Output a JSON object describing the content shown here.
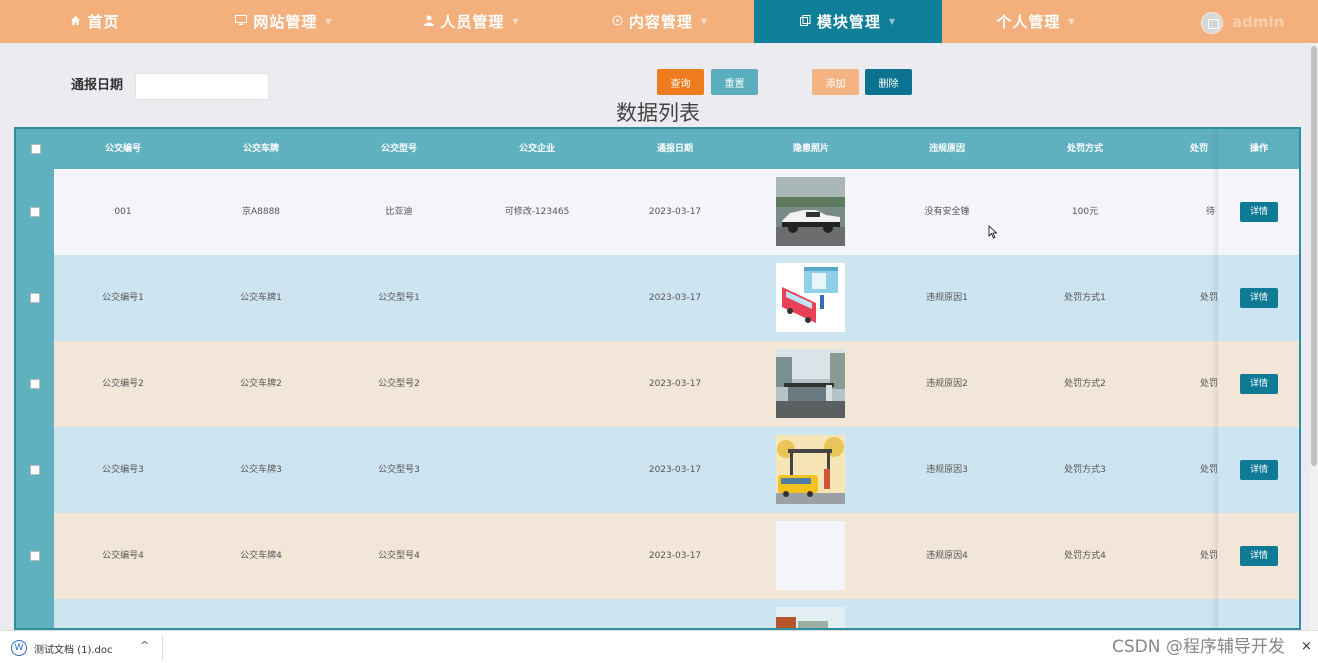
{
  "nav": {
    "items": [
      {
        "label": "首页",
        "icon": "home-icon",
        "active": false
      },
      {
        "label": "网站管理",
        "icon": "monitor-icon",
        "active": false
      },
      {
        "label": "人员管理",
        "icon": "user-icon",
        "active": false
      },
      {
        "label": "内容管理",
        "icon": "chat-icon",
        "active": false
      },
      {
        "label": "模块管理",
        "icon": "copy-icon",
        "active": true
      },
      {
        "label": "个人管理",
        "icon": "",
        "active": false
      }
    ],
    "user": "admin"
  },
  "search": {
    "label": "通报日期",
    "value": "",
    "query_button": "查询",
    "reset_button": "重置",
    "add_button": "添加",
    "delete_button": "删除"
  },
  "table": {
    "title": "数据列表",
    "headers": [
      "公交编号",
      "公交车牌",
      "公交型号",
      "公交企业",
      "通报日期",
      "隐患照片",
      "违规原因",
      "处罚方式",
      "处罚",
      "操作"
    ],
    "rows": [
      {
        "no": "001",
        "plate": "京A8888",
        "model": "比亚迪",
        "company": "可修改-123465",
        "date": "2023-03-17",
        "photo": "car-photo",
        "reason": "没有安全锤",
        "penalty": "100元",
        "status": "待",
        "action": "详情"
      },
      {
        "no": "公交编号1",
        "plate": "公交车牌1",
        "model": "公交型号1",
        "company": "",
        "date": "2023-03-17",
        "photo": "bus-stop-illustration",
        "reason": "违规原因1",
        "penalty": "处罚方式1",
        "status": "处罚",
        "action": "详情"
      },
      {
        "no": "公交编号2",
        "plate": "公交车牌2",
        "model": "公交型号2",
        "company": "",
        "date": "2023-03-17",
        "photo": "bus-shelter-photo",
        "reason": "违规原因2",
        "penalty": "处罚方式2",
        "status": "处罚",
        "action": "详情"
      },
      {
        "no": "公交编号3",
        "plate": "公交车牌3",
        "model": "公交型号3",
        "company": "",
        "date": "2023-03-17",
        "photo": "yellow-bus-illustration",
        "reason": "违规原因3",
        "penalty": "处罚方式3",
        "status": "处罚",
        "action": "详情"
      },
      {
        "no": "公交编号4",
        "plate": "公交车牌4",
        "model": "公交型号4",
        "company": "",
        "date": "2023-03-17",
        "photo": "blank-photo",
        "reason": "违规原因4",
        "penalty": "处罚方式4",
        "status": "处罚",
        "action": "详情"
      },
      {
        "no": "",
        "plate": "",
        "model": "",
        "company": "",
        "date": "",
        "photo": "street-photo",
        "reason": "",
        "penalty": "",
        "status": "",
        "action": ""
      }
    ]
  },
  "download_bar": {
    "file_name": "测试文档 (1).doc"
  },
  "watermark": "CSDN @程序辅导开发",
  "colors": {
    "nav_bg": "#f3b07d",
    "nav_active": "#0f7e99",
    "table_header": "#5fb1c0",
    "row_white": "#f4f5fa",
    "row_blue": "#cde4f1",
    "row_beige": "#f2e6d8",
    "query_btn": "#ee7c1f",
    "reset_btn": "#5aaebe",
    "add_btn": "#f5b384",
    "delete_btn": "#0b7390"
  }
}
